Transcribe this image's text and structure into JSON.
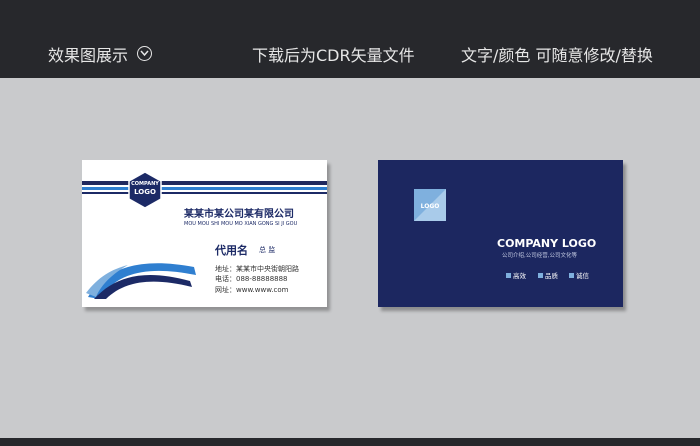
{
  "topbar": {
    "preview_label": "效果图展示",
    "download_label": "下载后为CDR矢量文件",
    "edit_label": "文字/颜色  可随意修改/替换"
  },
  "front_card": {
    "logo_top": "COMPANY",
    "logo_bottom": "LOGO",
    "company_name": "某某市某公司某有限公司",
    "company_pinyin": "MOU MOU SHI MOU MO XIAN GONG SI JI GOU",
    "person_name": "代用名",
    "person_title": "总 监",
    "address": "地址：某某市中央街朝阳路",
    "phone": "电话：088-88888888",
    "website": "网址：www.www.com"
  },
  "back_card": {
    "logo_text": "LOGO",
    "company_logo": "COMPANY LOGO",
    "tagline": "公司介绍,公司经营,公司文化等",
    "features": [
      "高效",
      "品质",
      "诚信"
    ]
  },
  "colors": {
    "navy": "#1c2760",
    "blue": "#2f7fd0",
    "light_blue": "#7fb0de",
    "background": "#c9cacc",
    "bar": "#27282c"
  },
  "icons": [
    "chevron-down-icon",
    "checkbox-icon"
  ]
}
